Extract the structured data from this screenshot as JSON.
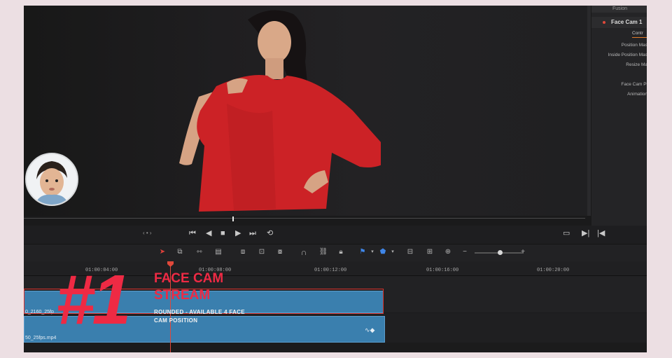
{
  "inspector": {
    "top_label": "Fusion",
    "title": "Face Cam 1",
    "tab": "Contr",
    "rows": [
      "Position Mas",
      "Inside Position Mas",
      "Resize Ma",
      "",
      "Face Cam Pi",
      "Animation"
    ]
  },
  "transport": {
    "nav_dots": "‹ • ›"
  },
  "timeline": {
    "ruler": [
      "01:00:04:00",
      "01:00:08:00",
      "01:00:12:00",
      "01:00:16:00",
      "01:00:20:00"
    ],
    "clip_video_label": "0_2160_25fp",
    "clip_audio_label": "50_25fps.mp4"
  },
  "overlay": {
    "number": "#1",
    "title_line1": "FACE CAM",
    "title_line2": "STREAM",
    "subtitle_line1": "ROUNDED - AVAILABLE 4 FACE",
    "subtitle_line2": "CAM POSITION"
  },
  "colors": {
    "accent_red": "#ee2a44",
    "clip_blue": "#3a7fae",
    "playhead": "#e0483a"
  }
}
